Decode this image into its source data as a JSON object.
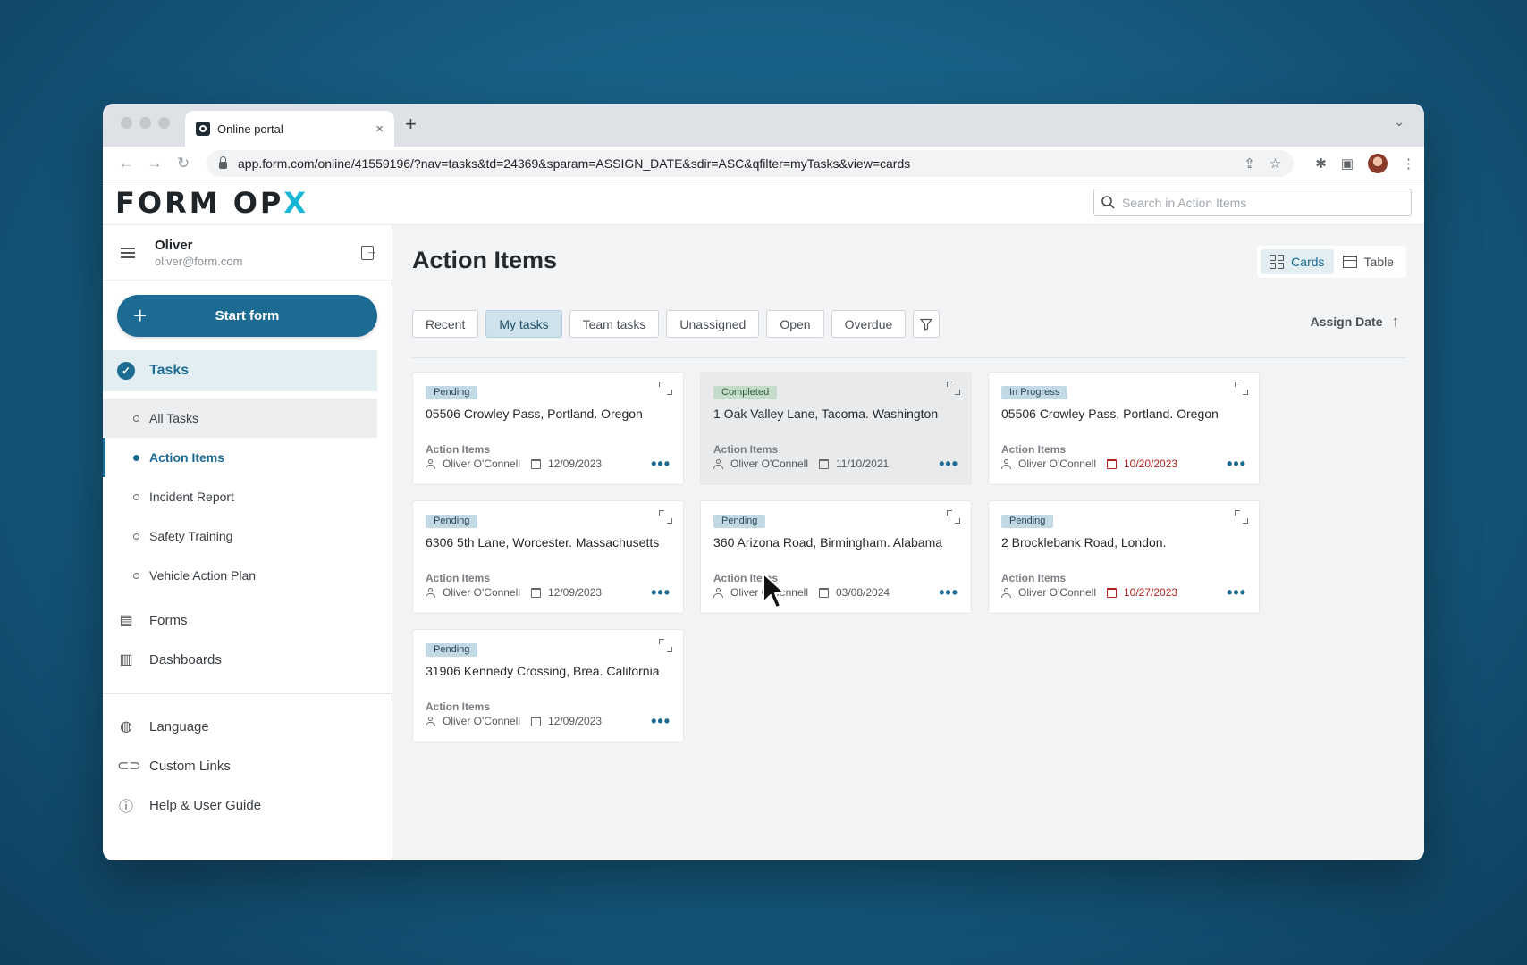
{
  "browser": {
    "tab_title": "Online portal",
    "tab_close": "×",
    "new_tab": "+",
    "url": "app.form.com/online/41559196/?nav=tasks&td=24369&sparam=ASSIGN_DATE&sdir=ASC&qfilter=myTasks&view=cards"
  },
  "header": {
    "logo_text": "FORM OP",
    "logo_accent": "X",
    "search_placeholder": "Search in Action Items"
  },
  "user": {
    "name": "Oliver",
    "email": "oliver@form.com"
  },
  "sidebar": {
    "start_form": "Start form",
    "tasks_label": "Tasks",
    "task_subitems": [
      {
        "label": "All Tasks"
      },
      {
        "label": "Action Items"
      },
      {
        "label": "Incident Report"
      },
      {
        "label": "Safety Training"
      },
      {
        "label": "Vehicle Action Plan"
      }
    ],
    "forms_label": "Forms",
    "dashboards_label": "Dashboards",
    "language_label": "Language",
    "custom_links_label": "Custom Links",
    "help_label": "Help & User Guide"
  },
  "main": {
    "title": "Action Items",
    "view_cards": "Cards",
    "view_table": "Table",
    "filters": [
      "Recent",
      "My tasks",
      "Team tasks",
      "Unassigned",
      "Open",
      "Overdue"
    ],
    "active_filter": "My tasks",
    "sort_label": "Assign Date",
    "sort_direction_icon": "↑"
  },
  "cards": [
    {
      "status": "Pending",
      "title": "05506 Crowley Pass, Portland. Oregon",
      "type": "Action Items",
      "assignee": "Oliver O'Connell",
      "date": "12/09/2023",
      "overdue": false
    },
    {
      "status": "Completed",
      "title": "1 Oak Valley Lane, Tacoma. Washington",
      "type": "Action Items",
      "assignee": "Oliver O'Connell",
      "date": "11/10/2021",
      "overdue": false
    },
    {
      "status": "In Progress",
      "title": "05506 Crowley Pass, Portland. Oregon",
      "type": "Action Items",
      "assignee": "Oliver O'Connell",
      "date": "10/20/2023",
      "overdue": true
    },
    {
      "status": "Pending",
      "title": "6306 5th Lane, Worcester. Massachusetts",
      "type": "Action Items",
      "assignee": "Oliver O'Connell",
      "date": "12/09/2023",
      "overdue": false
    },
    {
      "status": "Pending",
      "title": "360 Arizona Road, Birmingham. Alabama",
      "type": "Action Items",
      "assignee": "Oliver O'Connell",
      "date": "03/08/2024",
      "overdue": false
    },
    {
      "status": "Pending",
      "title": "2 Brocklebank Road, London.",
      "type": "Action Items",
      "assignee": "Oliver O'Connell",
      "date": "10/27/2023",
      "overdue": true
    },
    {
      "status": "Pending",
      "title": "31906 Kennedy Crossing, Brea. California",
      "type": "Action Items",
      "assignee": "Oliver O'Connell",
      "date": "12/09/2023",
      "overdue": false
    }
  ],
  "colors": {
    "brand": "#1c6b93",
    "accent": "#1ab6d6",
    "overdue": "#b3231f"
  }
}
